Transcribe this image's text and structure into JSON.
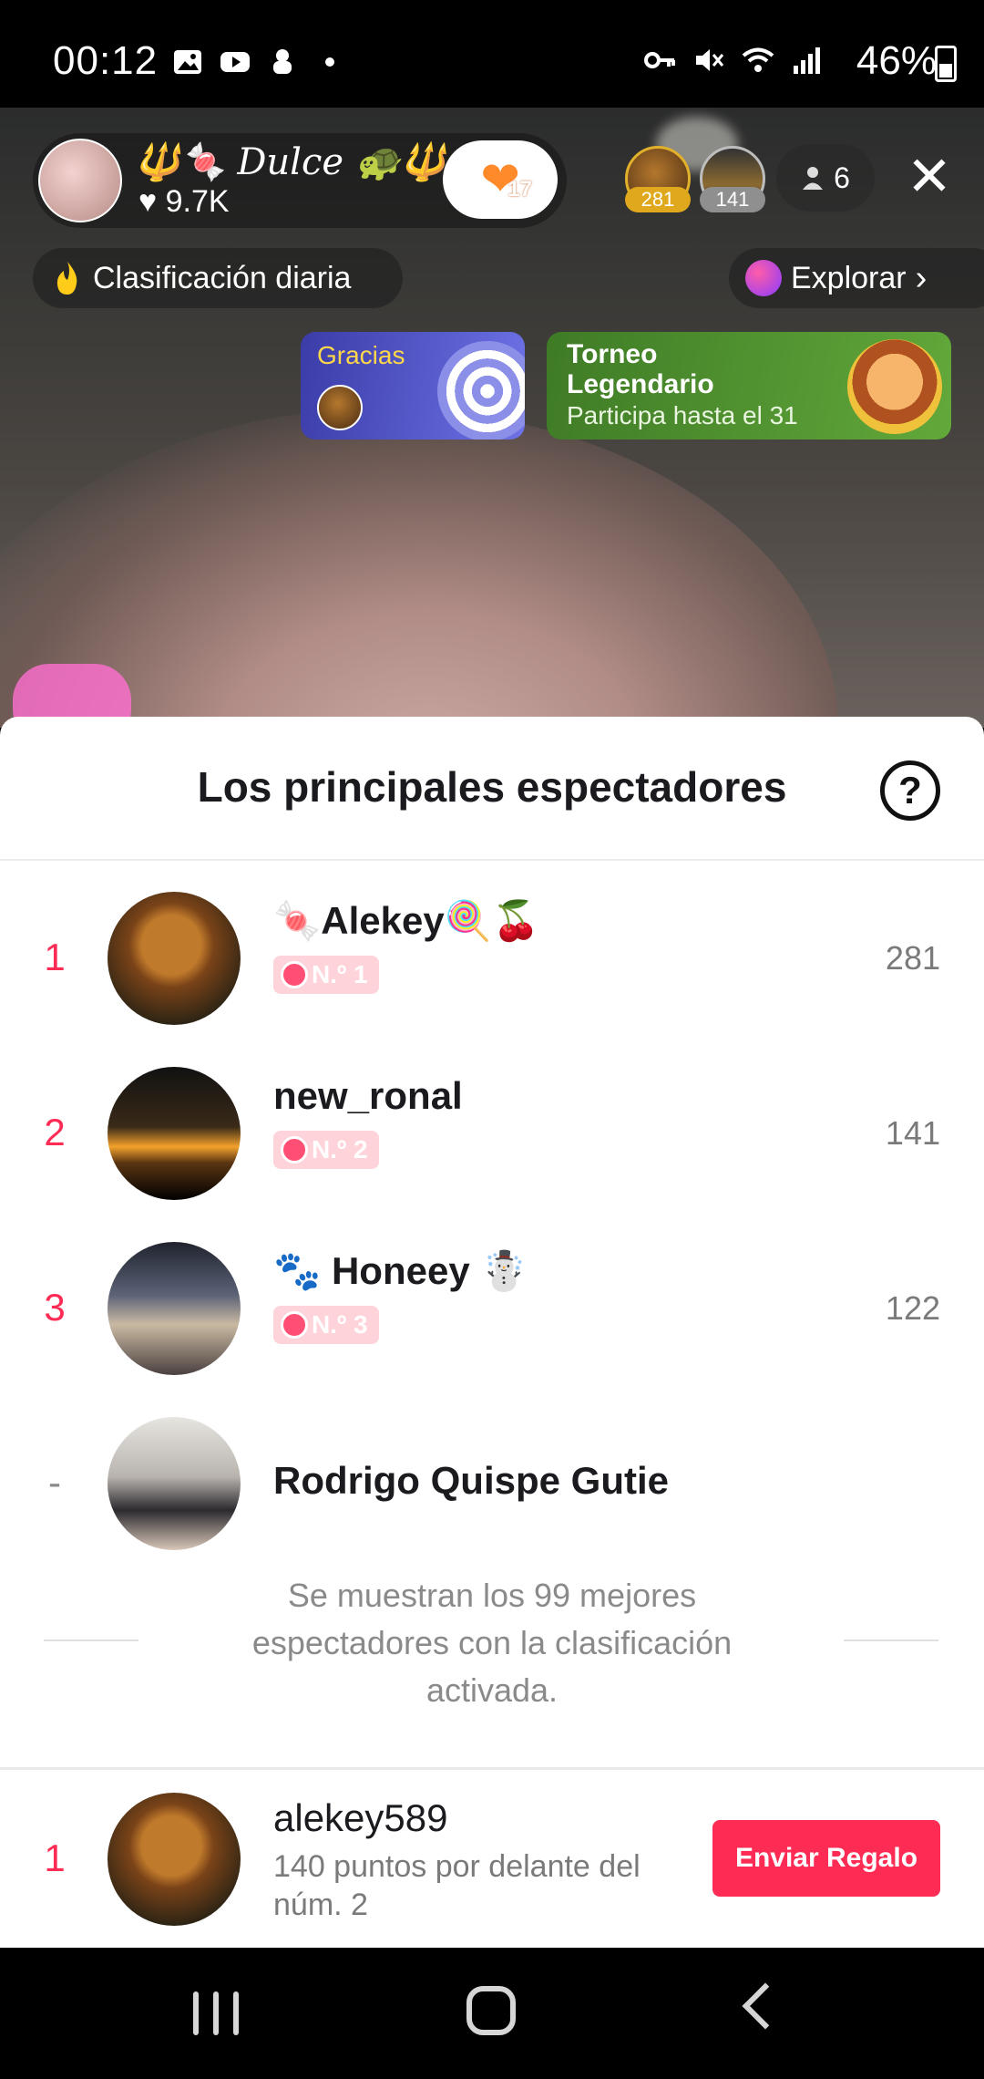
{
  "status_bar": {
    "time": "00:12",
    "battery": "46%"
  },
  "stream": {
    "host_name": "🔱🍬 Dulce 🐢🔱",
    "host_likes": "♥ 9.7K",
    "follow_count": "17",
    "top_viewers": [
      {
        "badge": "281"
      },
      {
        "badge": "141"
      }
    ],
    "viewer_count": "6",
    "ranking_label": "Clasificación diaria",
    "explore_label": "Explorar",
    "thanks_label": "Gracias",
    "tournament_title": "Torneo Legendario",
    "tournament_sub": "Participa hasta el 31"
  },
  "sheet": {
    "title": "Los principales espectadores",
    "rows": [
      {
        "rank": "1",
        "name": "🍬Alekey🍭🍒",
        "badge": "N.º 1",
        "score": "281"
      },
      {
        "rank": "2",
        "name": "new_ronal",
        "badge": "N.º 2",
        "score": "141"
      },
      {
        "rank": "3",
        "name": "🐾  Honeey     ☃️",
        "badge": "N.º 3",
        "score": "122"
      },
      {
        "rank": "-",
        "name": "Rodrigo Quispe Gutie"
      }
    ],
    "footnote": "Se muestran los 99 mejores espectadores con la clasificación activada.",
    "me": {
      "rank": "1",
      "name": "alekey589",
      "subtitle": "140 puntos por delante del núm. 2",
      "gift_button": "Enviar Regalo"
    }
  },
  "colors": {
    "accent": "#fe2c55",
    "badge_bg": "#ffd3da"
  }
}
